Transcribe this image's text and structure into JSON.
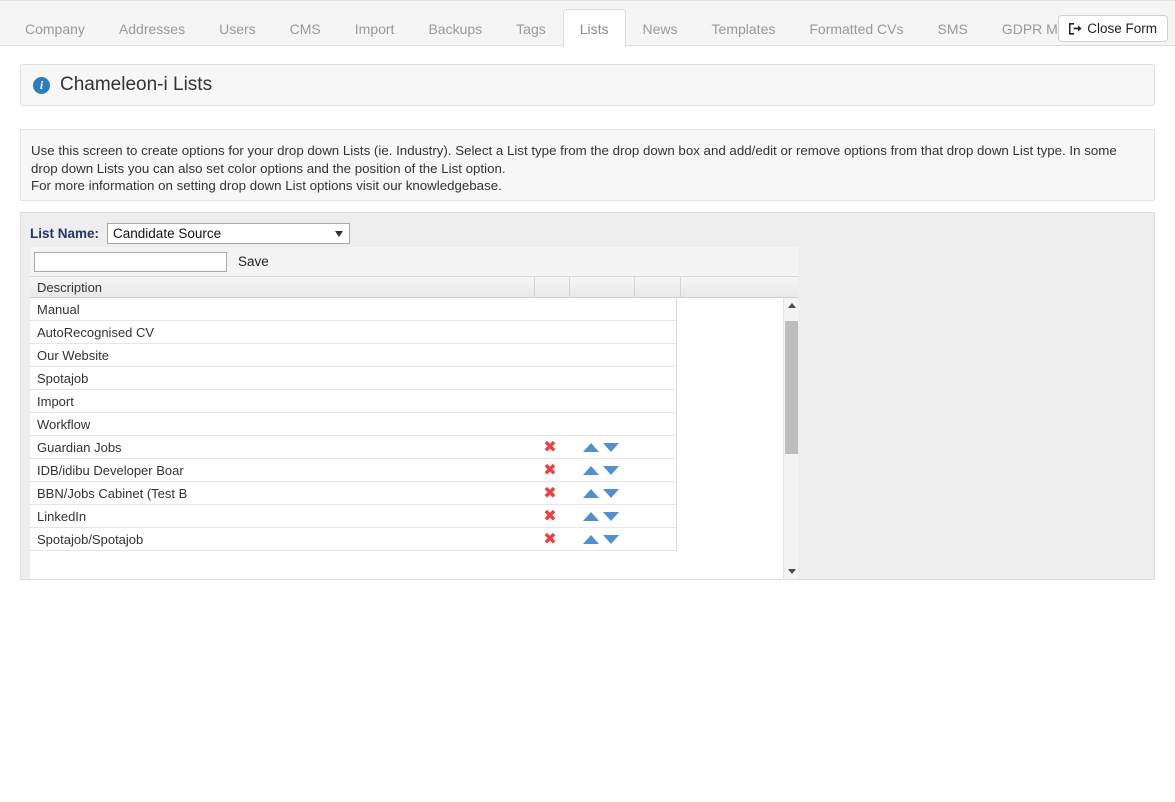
{
  "tabs": [
    {
      "label": "Company",
      "active": false
    },
    {
      "label": "Addresses",
      "active": false
    },
    {
      "label": "Users",
      "active": false
    },
    {
      "label": "CMS",
      "active": false
    },
    {
      "label": "Import",
      "active": false
    },
    {
      "label": "Backups",
      "active": false
    },
    {
      "label": "Tags",
      "active": false
    },
    {
      "label": "Lists",
      "active": true
    },
    {
      "label": "News",
      "active": false
    },
    {
      "label": "Templates",
      "active": false
    },
    {
      "label": "Formatted CVs",
      "active": false
    },
    {
      "label": "SMS",
      "active": false
    },
    {
      "label": "GDPR Monitor",
      "active": false
    }
  ],
  "close_form": {
    "label": "Close Form",
    "icon": "sign-out-icon"
  },
  "header": {
    "icon": "info-icon",
    "icon_glyph": "i",
    "title": "Chameleon-i Lists"
  },
  "instructions": {
    "line1": "Use this screen to create options for your drop down Lists (ie. Industry). Select a List type from the drop down box and add/edit or remove options from that drop down List type. In some drop down Lists you can also set color options and the position of the List option.",
    "line2": "For more information on setting drop down List options visit our knowledgebase."
  },
  "form": {
    "list_name_label": "List Name:",
    "list_name_selected": "Candidate Source",
    "list_name_options": [
      "Candidate Source"
    ],
    "add_input_value": "",
    "add_input_placeholder": "",
    "save_label": "Save"
  },
  "table": {
    "columns": [
      "Description",
      "",
      "",
      "",
      ""
    ],
    "rows": [
      {
        "description": "Manual",
        "has_actions": false
      },
      {
        "description": "AutoRecognised CV",
        "has_actions": false
      },
      {
        "description": "Our Website",
        "has_actions": false
      },
      {
        "description": "Spotajob",
        "has_actions": false
      },
      {
        "description": "Import",
        "has_actions": false
      },
      {
        "description": "Workflow",
        "has_actions": false
      },
      {
        "description": "Guardian Jobs",
        "has_actions": true
      },
      {
        "description": "IDB/idibu Developer Boar",
        "has_actions": true
      },
      {
        "description": "BBN/Jobs Cabinet (Test B",
        "has_actions": true
      },
      {
        "description": "LinkedIn",
        "has_actions": true
      },
      {
        "description": "Spotajob/Spotajob",
        "has_actions": true
      }
    ],
    "action_icons": {
      "delete": "x-icon",
      "move_up": "triangle-up-icon",
      "move_down": "triangle-down-icon"
    }
  },
  "scrollbar": {
    "up_icon": "scroll-up-arrow-icon",
    "down_icon": "scroll-down-arrow-icon",
    "thumb": "scroll-thumb"
  },
  "colors": {
    "accent_blue": "#2b7cc0",
    "label_navy": "#1f3864",
    "delete_red": "#ef4040",
    "arrow_blue": "#4f8fd4",
    "panel_bg": "#eeeeee"
  }
}
